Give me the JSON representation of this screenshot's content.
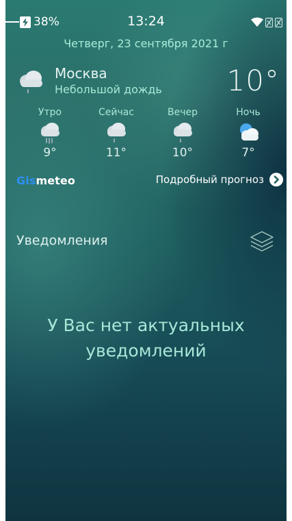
{
  "status": {
    "battery_percent": "38%",
    "time": "13:24",
    "icons": [
      "charging-battery-icon",
      "wifi-icon",
      "sim1-no-signal-icon",
      "sim2-no-signal-icon"
    ]
  },
  "date": "Четверг, 23 сентября 2021 г",
  "current": {
    "city": "Москва",
    "condition": "Небольшой дождь",
    "temperature": "10°",
    "icon": "cloud-light-rain-icon"
  },
  "periods": [
    {
      "label": "Утро",
      "temp": "9°",
      "icon": "cloud-rain-icon"
    },
    {
      "label": "Сейчас",
      "temp": "11°",
      "icon": "cloud-light-rain-icon"
    },
    {
      "label": "Вечер",
      "temp": "10°",
      "icon": "cloud-light-rain-icon"
    },
    {
      "label": "Ночь",
      "temp": "7°",
      "icon": "partly-cloudy-night-icon"
    }
  ],
  "provider": {
    "part1": "Gis",
    "part2": "meteo"
  },
  "forecast_link": "Подробный прогноз",
  "notifications": {
    "title": "Уведомления",
    "empty_line1": "У Вас нет актуальных",
    "empty_line2": "уведомлений"
  },
  "colors": {
    "accent_text": "#a9ecd9",
    "gismeteo_blue": "#2e8ff5",
    "background_top": "#2a7a72",
    "background_bottom": "#0f3440"
  }
}
